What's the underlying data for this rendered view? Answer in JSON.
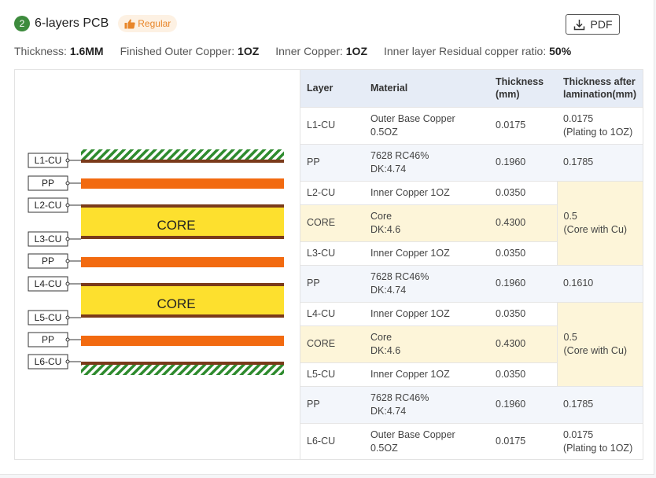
{
  "header": {
    "step_number": "2",
    "title": "6-layers PCB",
    "tag_label": "Regular",
    "pdf_label": "PDF"
  },
  "specs": [
    {
      "label": "Thickness:",
      "value": "1.6MM"
    },
    {
      "label": "Finished Outer Copper:",
      "value": "1OZ"
    },
    {
      "label": "Inner Copper:",
      "value": "1OZ"
    },
    {
      "label": "Inner layer Residual copper ratio:",
      "value": "50%"
    }
  ],
  "diagram": {
    "labels": [
      "L1-CU",
      "PP",
      "L2-CU",
      "L3-CU",
      "PP",
      "L4-CU",
      "L5-CU",
      "PP",
      "L6-CU"
    ],
    "core_labels": [
      "CORE",
      "CORE"
    ]
  },
  "colors": {
    "copper": "#7a3a1a",
    "prepreg": "#f26a10",
    "core": "#fde02e",
    "outer_hatch_green": "#2e8b2e",
    "header_bg": "#e6ecf6",
    "core_row_bg": "#fdf5d9",
    "badge_green": "#3d8b3d",
    "tag_orange": "#e8862a"
  },
  "table": {
    "headers": [
      "Layer",
      "Material",
      "Thickness\n(mm)",
      "Thickness after\nlamination(mm)"
    ],
    "rows": [
      {
        "layer": "L1-CU",
        "material": "Outer Base Copper\n0.5OZ",
        "thickness": "0.0175",
        "after": "0.0175\n(Plating to 1OZ)"
      },
      {
        "layer": "PP",
        "material": "7628 RC46%\nDK:4.74",
        "thickness": "0.1960",
        "after": "0.1785"
      },
      {
        "layer": "L2-CU",
        "material": "Inner Copper 1OZ",
        "thickness": "0.0350",
        "after": "0.5\n(Core with Cu)"
      },
      {
        "layer": "CORE",
        "material": "Core\nDK:4.6",
        "thickness": "0.4300"
      },
      {
        "layer": "L3-CU",
        "material": "Inner Copper 1OZ",
        "thickness": "0.0350"
      },
      {
        "layer": "PP",
        "material": "7628 RC46%\nDK:4.74",
        "thickness": "0.1960",
        "after": "0.1610"
      },
      {
        "layer": "L4-CU",
        "material": "Inner Copper 1OZ",
        "thickness": "0.0350",
        "after": "0.5\n(Core with Cu)"
      },
      {
        "layer": "CORE",
        "material": "Core\nDK:4.6",
        "thickness": "0.4300"
      },
      {
        "layer": "L5-CU",
        "material": "Inner Copper 1OZ",
        "thickness": "0.0350"
      },
      {
        "layer": "PP",
        "material": "7628 RC46%\nDK:4.74",
        "thickness": "0.1960",
        "after": "0.1785"
      },
      {
        "layer": "L6-CU",
        "material": "Outer Base Copper\n0.5OZ",
        "thickness": "0.0175",
        "after": "0.0175\n(Plating to 1OZ)"
      }
    ]
  }
}
